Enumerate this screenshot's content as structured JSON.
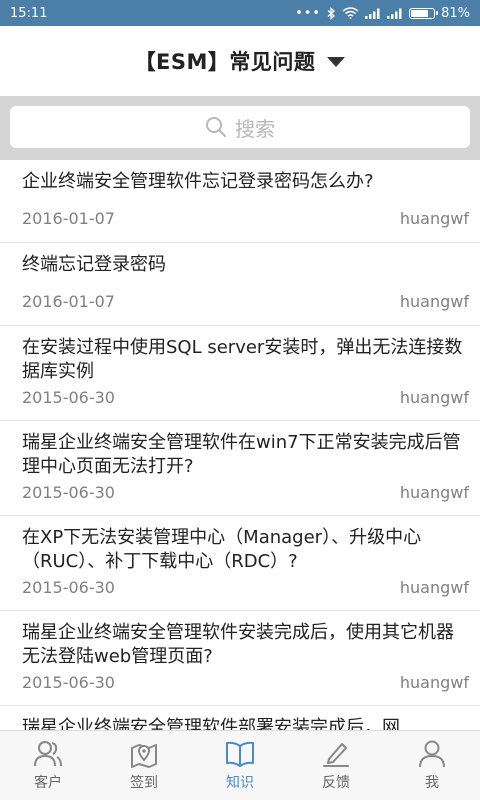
{
  "status_bar": {
    "time": "15:11",
    "battery": "81%",
    "battery_level": 0.81
  },
  "header": {
    "title": "【ESM】常见问题",
    "dropdown_icon": "caret-down-icon"
  },
  "search": {
    "placeholder": "搜索",
    "icon": "search-icon"
  },
  "list": {
    "items": [
      {
        "title": "企业终端安全管理软件忘记登录密码怎么办?",
        "date": "2016-01-07",
        "author": "huangwf"
      },
      {
        "title": "终端忘记登录密码",
        "date": "2016-01-07",
        "author": "huangwf"
      },
      {
        "title": "在安装过程中使用SQL server安装时，弹出无法连接数据库实例",
        "date": "2015-06-30",
        "author": "huangwf"
      },
      {
        "title": "瑞星企业终端安全管理软件在win7下正常安装完成后管理中心页面无法打开?",
        "date": "2015-06-30",
        "author": "huangwf"
      },
      {
        "title": "在XP下无法安装管理中心（Manager）、升级中心（RUC）、补丁下载中心（RDC）?",
        "date": "2015-06-30",
        "author": "huangwf"
      },
      {
        "title": "瑞星企业终端安全管理软件安装完成后，使用其它机器无法登陆web管理页面?",
        "date": "2015-06-30",
        "author": "huangwf"
      },
      {
        "title": "瑞星企业终端安全管理软件部署安装完成后，网",
        "date": "",
        "author": ""
      }
    ]
  },
  "tabbar": {
    "active_color": "#4a8bc9",
    "tabs": [
      {
        "label": "客户",
        "icon": "customers-icon"
      },
      {
        "label": "签到",
        "icon": "location-checkin-icon"
      },
      {
        "label": "知识",
        "icon": "book-icon"
      },
      {
        "label": "反馈",
        "icon": "edit-icon"
      },
      {
        "label": "我",
        "icon": "user-icon"
      }
    ]
  }
}
